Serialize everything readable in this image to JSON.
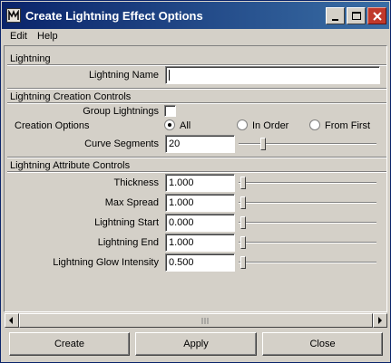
{
  "window": {
    "title": "Create Lightning Effect Options",
    "icon": "maya-app-icon"
  },
  "menu": {
    "edit": "Edit",
    "help": "Help"
  },
  "lightning_section": {
    "title": "Lightning",
    "name_label": "Lightning Name",
    "name_value": ""
  },
  "creation_section": {
    "title": "Lightning Creation Controls",
    "group_label": "Group Lightnings",
    "group_checked": false,
    "options_label": "Creation Options",
    "options": [
      {
        "label": "All",
        "selected": true
      },
      {
        "label": "In Order",
        "selected": false
      },
      {
        "label": "From First",
        "selected": false
      }
    ],
    "segments_label": "Curve Segments",
    "segments_value": "20"
  },
  "attribute_section": {
    "title": "Lightning Attribute Controls",
    "rows": [
      {
        "label": "Thickness",
        "value": "1.000"
      },
      {
        "label": "Max Spread",
        "value": "1.000"
      },
      {
        "label": "Lightning Start",
        "value": "0.000"
      },
      {
        "label": "Lightning End",
        "value": "1.000"
      },
      {
        "label": "Lightning Glow Intensity",
        "value": "0.500"
      }
    ]
  },
  "buttons": {
    "create": "Create",
    "apply": "Apply",
    "close": "Close"
  }
}
